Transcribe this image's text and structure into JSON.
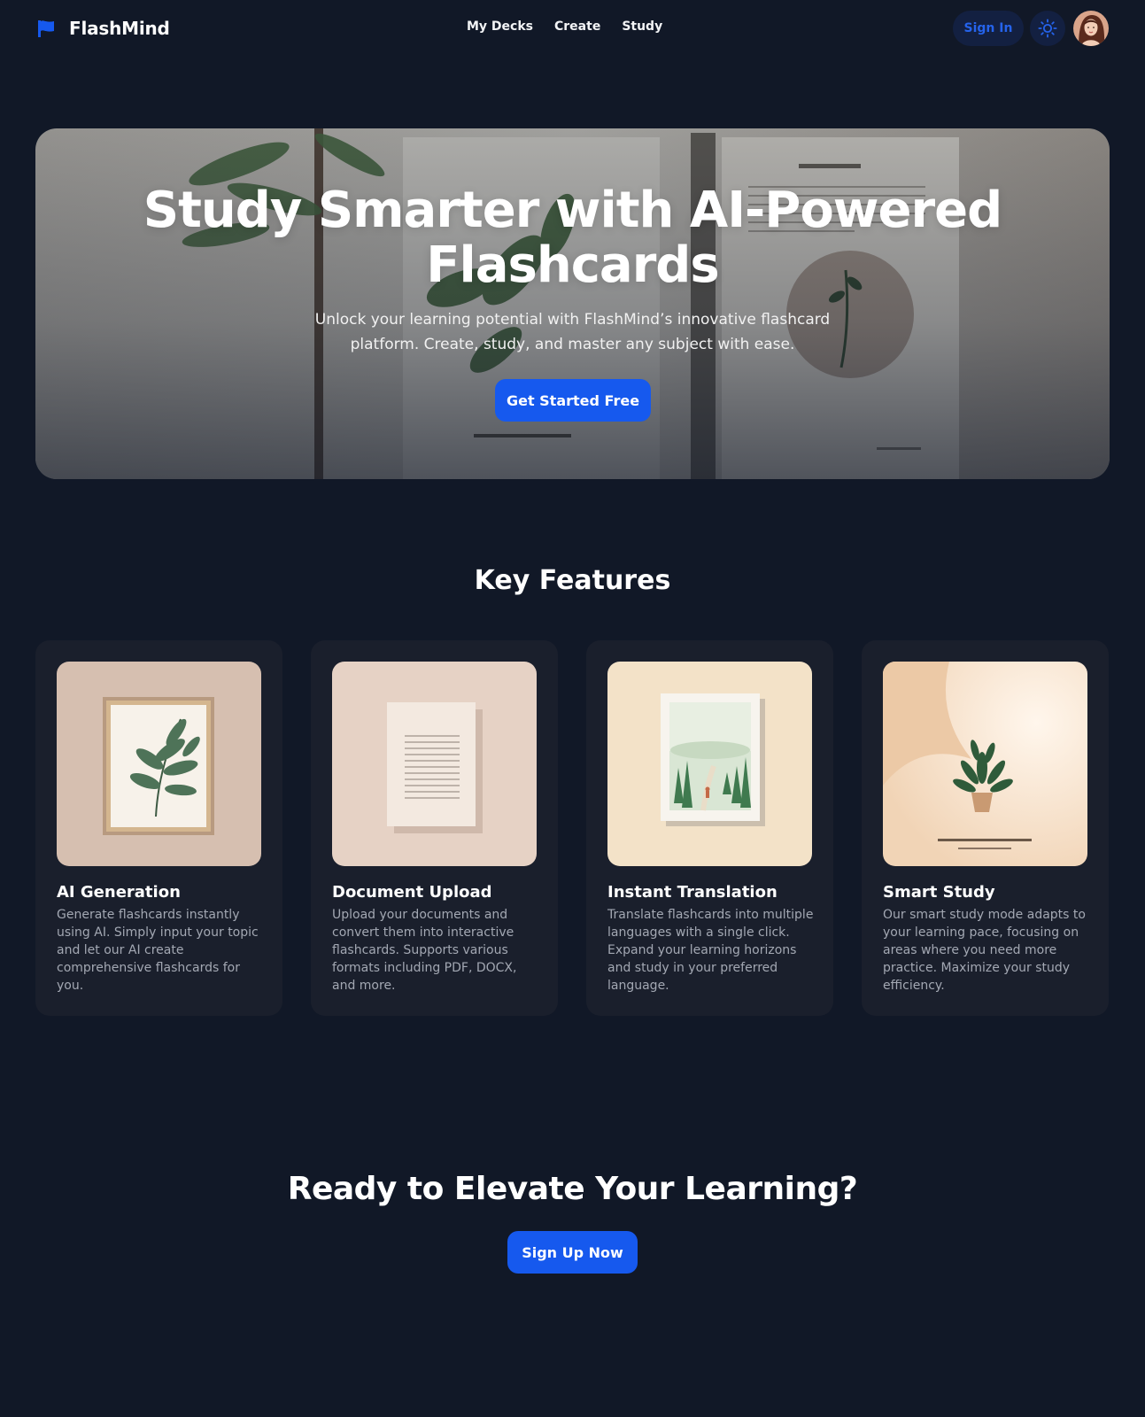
{
  "nav": {
    "brand": "FlashMind",
    "links": [
      "My Decks",
      "Create",
      "Study"
    ],
    "sign_in": "Sign In",
    "theme_icon": "sun-icon",
    "accent": "#1659ee"
  },
  "hero": {
    "title": "Study Smarter with AI-Powered Flashcards",
    "subtitle": "Unlock your learning potential with FlashMind’s innovative flashcard platform. Create, study, and master any subject with ease.",
    "cta": "Get Started Free"
  },
  "features": {
    "heading": "Key Features",
    "items": [
      {
        "title": "AI Generation",
        "description": "Generate flashcards instantly using AI. Simply input your topic and let our AI create comprehensive flashcards for you."
      },
      {
        "title": "Document Upload",
        "description": "Upload your documents and convert them into interactive flashcards. Supports various formats including PDF, DOCX, and more."
      },
      {
        "title": "Instant Translation",
        "description": "Translate flashcards into multiple languages with a single click. Expand your learning horizons and study in your preferred language."
      },
      {
        "title": "Smart Study",
        "description": "Our smart study mode adapts to your learning pace, focusing on areas where you need more practice. Maximize your study efficiency."
      }
    ]
  },
  "cta": {
    "heading": "Ready to Elevate Your Learning?",
    "button": "Sign Up Now"
  },
  "colors": {
    "background": "#111827",
    "card": "#1a1f2c",
    "primary": "#1659ee"
  }
}
